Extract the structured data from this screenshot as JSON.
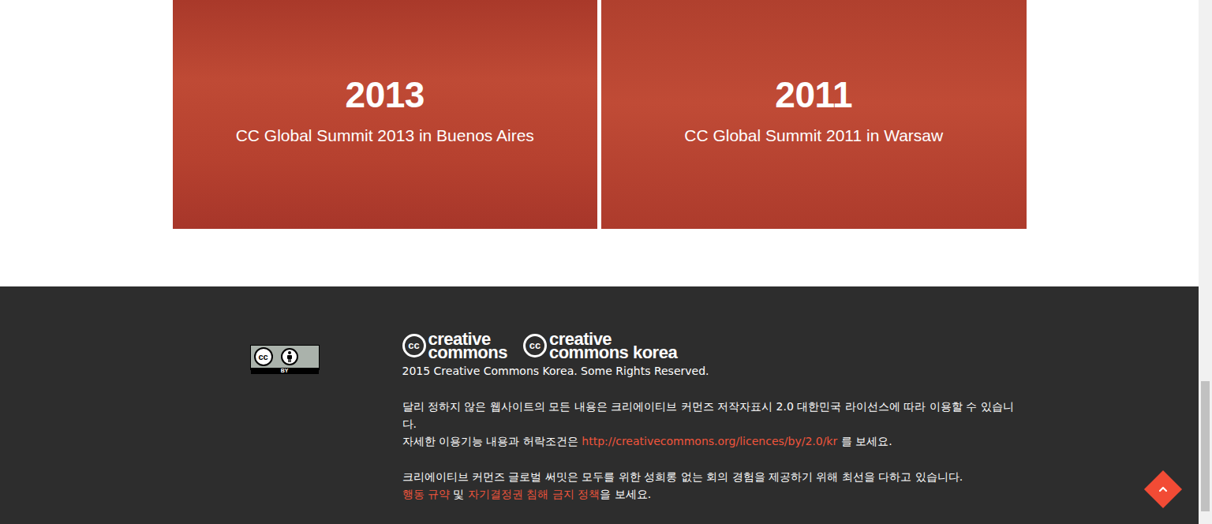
{
  "gallery": [
    {
      "year": "2013",
      "caption": "CC Global Summit 2013 in Buenos Aires"
    },
    {
      "year": "2011",
      "caption": "CC Global Summit 2011 in Warsaw"
    }
  ],
  "footer": {
    "badge": {
      "mark": "cc",
      "label": "BY"
    },
    "logos": [
      {
        "mark": "cc",
        "line1": "creative",
        "line2": "commons"
      },
      {
        "mark": "cc",
        "line1": "creative",
        "line2": "commons korea"
      }
    ],
    "copyright": "2015 Creative Commons Korea. Some Rights Reserved.",
    "paragraphs": [
      [
        [
          {
            "text": "달리 정하지 않은 웹사이트의 모든 내용은 크리에이티브 커먼즈 저작자표시 2.0 대한민국 라이선스에 따라 이용할 수 있습니다.",
            "kind": "text"
          }
        ],
        [
          {
            "text": "자세한 이용기능 내용과 허락조건은 ",
            "kind": "text"
          },
          {
            "text": "http://creativecommons.org/licences/by/2.0/kr",
            "kind": "link"
          },
          {
            "text": " 를 보세요.",
            "kind": "text"
          }
        ]
      ],
      [
        [
          {
            "text": "크리에이티브 커먼즈 글로벌 써밋은 모두를 위한 성희롱 없는 회의 경험을 제공하기 위해 최선을 다하고 있습니다.",
            "kind": "text"
          }
        ],
        [
          {
            "text": "행동 규약",
            "kind": "link"
          },
          {
            "text": " 및 ",
            "kind": "text"
          },
          {
            "text": "자기결정권 침해 금지 정책",
            "kind": "link"
          },
          {
            "text": "을 보세요.",
            "kind": "text"
          }
        ]
      ]
    ]
  }
}
